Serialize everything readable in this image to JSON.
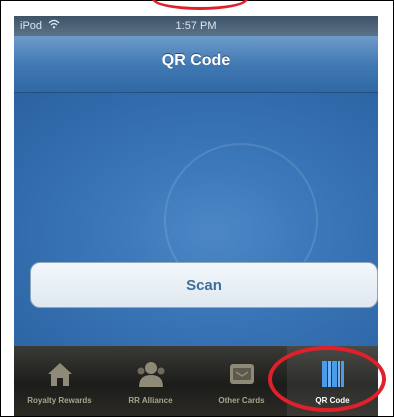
{
  "status": {
    "carrier": "iPod",
    "time": "1:57 PM"
  },
  "nav": {
    "title": "QR Code"
  },
  "main": {
    "scan_label": "Scan"
  },
  "tabs": [
    {
      "label": "Royalty Rewards",
      "icon": "house-icon"
    },
    {
      "label": "RR Alliance",
      "icon": "people-icon"
    },
    {
      "label": "Other Cards",
      "icon": "card-icon"
    },
    {
      "label": "QR Code",
      "icon": "qr-code-icon",
      "selected": true
    }
  ],
  "colors": {
    "accent": "#3f77b2",
    "annotation": "#e0202a",
    "tab_bar": "#1c1c1a"
  }
}
